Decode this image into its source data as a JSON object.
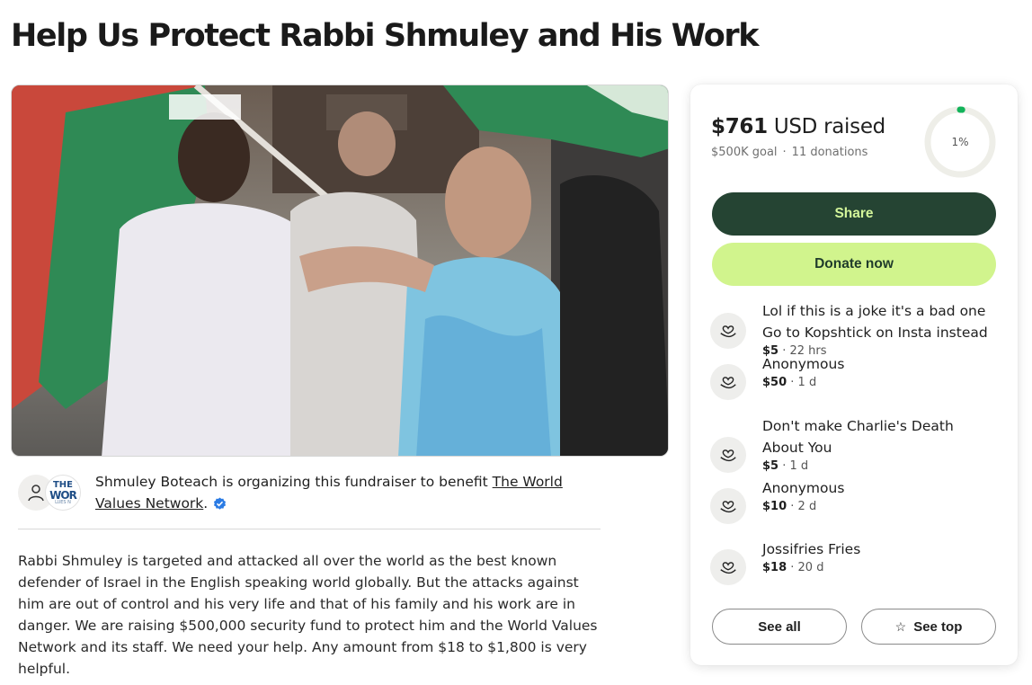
{
  "page": {
    "title": "Help Us Protect Rabbi Shmuley and His Work"
  },
  "organizer": {
    "text_prefix": "Shmuley Boteach is organizing this fundraiser to benefit ",
    "beneficiary": "The World Values Network",
    "text_suffix": ".",
    "org_avatar": {
      "line1": "THE",
      "line2": "WOR",
      "line3": "LUES N"
    },
    "verified_color": "#2a7be4"
  },
  "story": {
    "text": "Rabbi Shmuley is targeted and attacked all over the world as the best known defender of Israel in the English speaking world globally. But the attacks against him are out of control and his very life and that of his family and his work are in danger. We are raising $500,000 security fund to protect him and the World Values Network and its staff. We need your help. Any amount from $18 to $1,800 is very helpful."
  },
  "summary": {
    "raised_amount": "$761",
    "raised_suffix": " USD raised",
    "goal": "$500K goal",
    "separator": "·",
    "donations_count": "11 donations",
    "progress_label": "1%",
    "progress_fraction": 0.01,
    "progress_color": "#12b35a"
  },
  "buttons": {
    "share": "Share",
    "donate": "Donate now",
    "see_all": "See all",
    "see_top": "See top"
  },
  "donations": [
    {
      "name": "Lol if this is a joke it's a bad one Go to Kopshtick on Insta instead",
      "amount": "$5",
      "time": " · 22 hrs"
    },
    {
      "name": "Anonymous",
      "amount": "$50",
      "time": " · 1 d"
    },
    {
      "name": "Don't make Charlie's Death About You",
      "amount": "$5",
      "time": " · 1 d"
    },
    {
      "name": "Anonymous",
      "amount": "$10",
      "time": " · 2 d"
    },
    {
      "name": "Jossifries Fries",
      "amount": "$18",
      "time": " · 20 d"
    }
  ],
  "colors": {
    "share_bg": "#254433",
    "share_text": "#d3f59a",
    "donate_bg": "#d1f48d",
    "donate_text": "#1f3b2b"
  }
}
